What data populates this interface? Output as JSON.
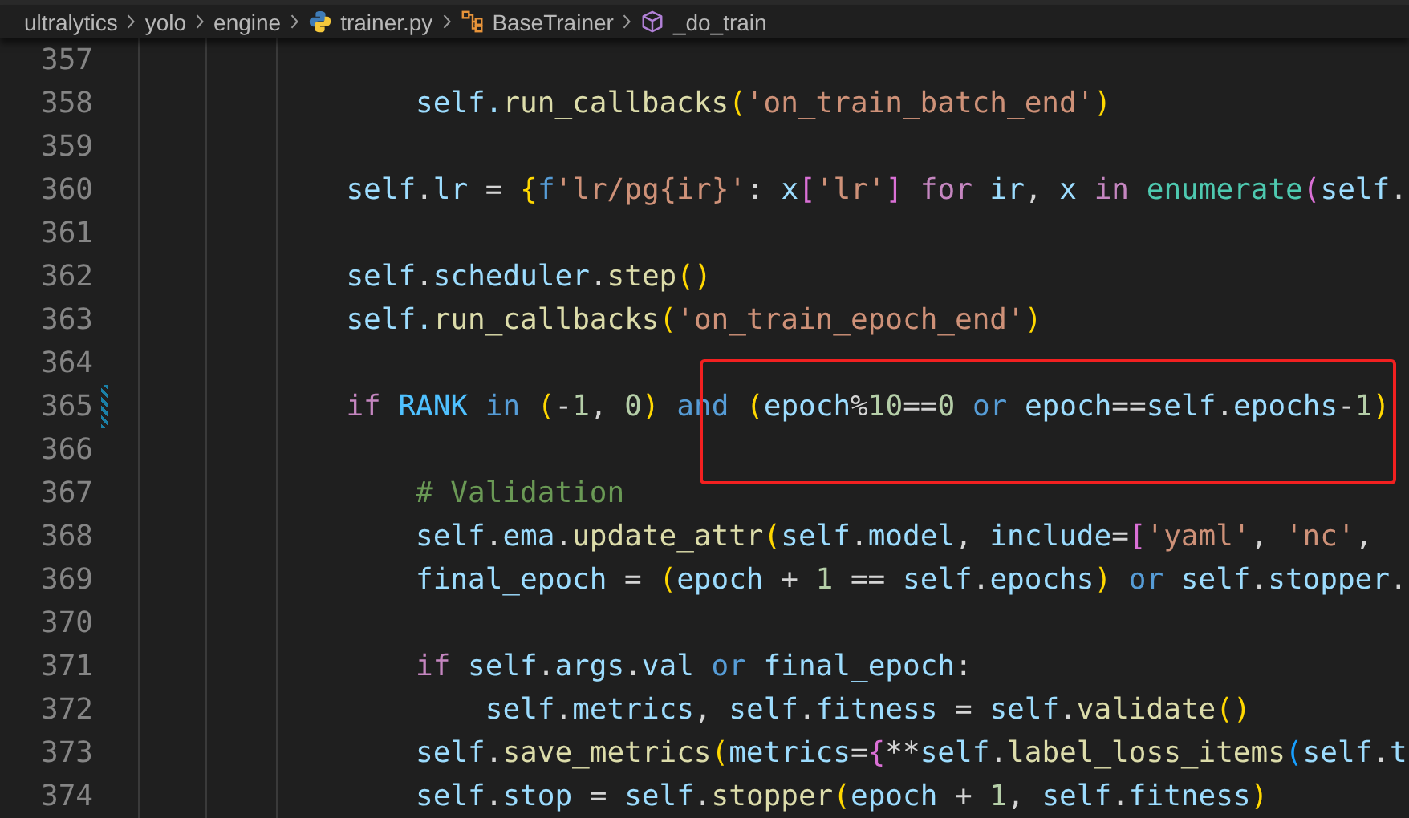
{
  "breadcrumb": [
    {
      "kind": "folder",
      "label": "ultralytics"
    },
    {
      "kind": "folder",
      "label": "yolo"
    },
    {
      "kind": "folder",
      "label": "engine"
    },
    {
      "kind": "python-file",
      "label": "trainer.py"
    },
    {
      "kind": "class",
      "label": "BaseTrainer"
    },
    {
      "kind": "method",
      "label": "_do_train"
    }
  ],
  "lines": [
    {
      "number": "357",
      "modified": false
    },
    {
      "number": "358",
      "modified": false,
      "kind": "loop",
      "tokens": [
        {
          "kind": "var",
          "text": "self."
        },
        {
          "kind": "fn",
          "text": "run_callbacks"
        },
        {
          "kind": "b1",
          "text": "("
        },
        {
          "kind": "str",
          "text": "'on_train_batch_end'"
        },
        {
          "kind": "b1",
          "text": ")"
        }
      ]
    },
    {
      "number": "359",
      "modified": false
    },
    {
      "number": "360",
      "modified": false,
      "kind": "method",
      "tokens": [
        {
          "kind": "var",
          "text": "self"
        },
        {
          "kind": "p",
          "text": "."
        },
        {
          "kind": "var",
          "text": "lr"
        },
        {
          "kind": "p",
          "text": " = "
        },
        {
          "kind": "b1",
          "text": "{"
        },
        {
          "kind": "kw2",
          "text": "f"
        },
        {
          "kind": "str",
          "text": "'lr/pg{ir}'"
        },
        {
          "kind": "p",
          "text": ": "
        },
        {
          "kind": "var",
          "text": "x"
        },
        {
          "kind": "b2",
          "text": "["
        },
        {
          "kind": "str",
          "text": "'lr'"
        },
        {
          "kind": "b2",
          "text": "] "
        },
        {
          "kind": "kw",
          "text": "for "
        },
        {
          "kind": "var",
          "text": "ir"
        },
        {
          "kind": "p",
          "text": ", "
        },
        {
          "kind": "var",
          "text": "x "
        },
        {
          "kind": "kw",
          "text": "in "
        },
        {
          "kind": "builtin",
          "text": "enumerate"
        },
        {
          "kind": "b2",
          "text": "("
        },
        {
          "kind": "var",
          "text": "self"
        },
        {
          "kind": "p",
          "text": "."
        }
      ]
    },
    {
      "number": "361",
      "modified": false
    },
    {
      "number": "362",
      "modified": false,
      "kind": "method",
      "tokens": [
        {
          "kind": "var",
          "text": "self"
        },
        {
          "kind": "p",
          "text": "."
        },
        {
          "kind": "var",
          "text": "scheduler"
        },
        {
          "kind": "p",
          "text": "."
        },
        {
          "kind": "fn",
          "text": "step"
        },
        {
          "kind": "b1",
          "text": "()"
        }
      ]
    },
    {
      "number": "363",
      "modified": false,
      "kind": "method",
      "tokens": [
        {
          "kind": "var",
          "text": "self."
        },
        {
          "kind": "fn",
          "text": "run_callbacks"
        },
        {
          "kind": "b1",
          "text": "("
        },
        {
          "kind": "str",
          "text": "'on_train_epoch_end'"
        },
        {
          "kind": "b1",
          "text": ")"
        }
      ]
    },
    {
      "number": "364",
      "modified": false
    },
    {
      "number": "365",
      "modified": true,
      "kind": "method",
      "tokens": [
        {
          "kind": "kw",
          "text": "if "
        },
        {
          "kind": "const",
          "text": "RANK "
        },
        {
          "kind": "kw2",
          "text": "in "
        },
        {
          "kind": "b1",
          "text": "("
        },
        {
          "kind": "p",
          "text": "-"
        },
        {
          "kind": "num",
          "text": "1"
        },
        {
          "kind": "p",
          "text": ", "
        },
        {
          "kind": "num",
          "text": "0"
        },
        {
          "kind": "b1",
          "text": ") "
        },
        {
          "kind": "kw2",
          "text": "and "
        },
        {
          "kind": "b1",
          "text": "("
        },
        {
          "kind": "var",
          "text": "epoch"
        },
        {
          "kind": "p",
          "text": "%"
        },
        {
          "kind": "num",
          "text": "10"
        },
        {
          "kind": "p",
          "text": "=="
        },
        {
          "kind": "num",
          "text": "0 "
        },
        {
          "kind": "kw2",
          "text": "or "
        },
        {
          "kind": "var",
          "text": "epoch"
        },
        {
          "kind": "p",
          "text": "=="
        },
        {
          "kind": "var",
          "text": "self"
        },
        {
          "kind": "p",
          "text": "."
        },
        {
          "kind": "var",
          "text": "epochs"
        },
        {
          "kind": "p",
          "text": "-"
        },
        {
          "kind": "num",
          "text": "1"
        },
        {
          "kind": "b1",
          "text": ")"
        }
      ]
    },
    {
      "number": "366",
      "modified": false
    },
    {
      "number": "367",
      "modified": false,
      "kind": "loop",
      "tokens": [
        {
          "kind": "comment",
          "text": "# Validation"
        }
      ]
    },
    {
      "number": "368",
      "modified": false,
      "kind": "loop",
      "tokens": [
        {
          "kind": "var",
          "text": "self"
        },
        {
          "kind": "p",
          "text": "."
        },
        {
          "kind": "var",
          "text": "ema"
        },
        {
          "kind": "p",
          "text": "."
        },
        {
          "kind": "fn",
          "text": "update_attr"
        },
        {
          "kind": "b1",
          "text": "("
        },
        {
          "kind": "var",
          "text": "self"
        },
        {
          "kind": "p",
          "text": "."
        },
        {
          "kind": "var",
          "text": "model"
        },
        {
          "kind": "p",
          "text": ", "
        },
        {
          "kind": "var",
          "text": "include"
        },
        {
          "kind": "p",
          "text": "="
        },
        {
          "kind": "b2",
          "text": "["
        },
        {
          "kind": "str",
          "text": "'yaml'"
        },
        {
          "kind": "p",
          "text": ", "
        },
        {
          "kind": "str",
          "text": "'nc'"
        },
        {
          "kind": "p",
          "text": ","
        }
      ]
    },
    {
      "number": "369",
      "modified": false,
      "kind": "loop",
      "tokens": [
        {
          "kind": "var",
          "text": "final_epoch"
        },
        {
          "kind": "p",
          "text": " = "
        },
        {
          "kind": "b1",
          "text": "("
        },
        {
          "kind": "var",
          "text": "epoch"
        },
        {
          "kind": "p",
          "text": " + "
        },
        {
          "kind": "num",
          "text": "1"
        },
        {
          "kind": "p",
          "text": " == "
        },
        {
          "kind": "var",
          "text": "self"
        },
        {
          "kind": "p",
          "text": "."
        },
        {
          "kind": "var",
          "text": "epochs"
        },
        {
          "kind": "b1",
          "text": ") "
        },
        {
          "kind": "kw2",
          "text": "or "
        },
        {
          "kind": "var",
          "text": "self"
        },
        {
          "kind": "p",
          "text": "."
        },
        {
          "kind": "var",
          "text": "stopper"
        },
        {
          "kind": "p",
          "text": "."
        }
      ]
    },
    {
      "number": "370",
      "modified": false
    },
    {
      "number": "371",
      "modified": false,
      "kind": "loop",
      "tokens": [
        {
          "kind": "kw",
          "text": "if "
        },
        {
          "kind": "var",
          "text": "self"
        },
        {
          "kind": "p",
          "text": "."
        },
        {
          "kind": "var",
          "text": "args"
        },
        {
          "kind": "p",
          "text": "."
        },
        {
          "kind": "var",
          "text": "val "
        },
        {
          "kind": "kw2",
          "text": "or "
        },
        {
          "kind": "var",
          "text": "final_epoch"
        },
        {
          "kind": "p",
          "text": ":"
        }
      ]
    },
    {
      "number": "372",
      "modified": false,
      "kind": "branch",
      "tokens": [
        {
          "kind": "var",
          "text": "self"
        },
        {
          "kind": "p",
          "text": "."
        },
        {
          "kind": "var",
          "text": "metrics"
        },
        {
          "kind": "p",
          "text": ", "
        },
        {
          "kind": "var",
          "text": "self"
        },
        {
          "kind": "p",
          "text": "."
        },
        {
          "kind": "var",
          "text": "fitness"
        },
        {
          "kind": "p",
          "text": " = "
        },
        {
          "kind": "var",
          "text": "self"
        },
        {
          "kind": "p",
          "text": "."
        },
        {
          "kind": "fn",
          "text": "validate"
        },
        {
          "kind": "b1",
          "text": "()"
        }
      ]
    },
    {
      "number": "373",
      "modified": false,
      "kind": "loop",
      "tokens": [
        {
          "kind": "var",
          "text": "self"
        },
        {
          "kind": "p",
          "text": "."
        },
        {
          "kind": "fn",
          "text": "save_metrics"
        },
        {
          "kind": "b1",
          "text": "("
        },
        {
          "kind": "var",
          "text": "metrics"
        },
        {
          "kind": "p",
          "text": "="
        },
        {
          "kind": "b2",
          "text": "{"
        },
        {
          "kind": "p",
          "text": "**"
        },
        {
          "kind": "var",
          "text": "self"
        },
        {
          "kind": "p",
          "text": "."
        },
        {
          "kind": "fn",
          "text": "label_loss_items"
        },
        {
          "kind": "b3",
          "text": "("
        },
        {
          "kind": "var",
          "text": "self"
        },
        {
          "kind": "p",
          "text": "."
        },
        {
          "kind": "var",
          "text": "t"
        }
      ]
    },
    {
      "number": "374",
      "modified": false,
      "kind": "loop",
      "tokens": [
        {
          "kind": "var",
          "text": "self"
        },
        {
          "kind": "p",
          "text": "."
        },
        {
          "kind": "var",
          "text": "stop"
        },
        {
          "kind": "p",
          "text": " = "
        },
        {
          "kind": "var",
          "text": "self"
        },
        {
          "kind": "p",
          "text": "."
        },
        {
          "kind": "fn",
          "text": "stopper"
        },
        {
          "kind": "b1",
          "text": "("
        },
        {
          "kind": "var",
          "text": "epoch"
        },
        {
          "kind": "p",
          "text": " + "
        },
        {
          "kind": "num",
          "text": "1"
        },
        {
          "kind": "p",
          "text": ", "
        },
        {
          "kind": "var",
          "text": "self"
        },
        {
          "kind": "p",
          "text": "."
        },
        {
          "kind": "var",
          "text": "fitness"
        },
        {
          "kind": "b1",
          "text": ")"
        }
      ]
    }
  ]
}
